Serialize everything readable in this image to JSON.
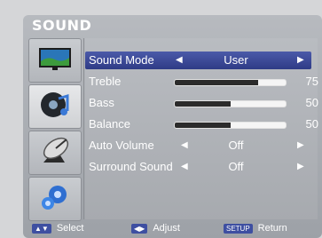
{
  "menu": {
    "title": "SOUND"
  },
  "sidebar": {
    "items": [
      {
        "name": "picture",
        "icon": "tv-screen-icon"
      },
      {
        "name": "sound",
        "icon": "music-note-icon",
        "active": true
      },
      {
        "name": "channel",
        "icon": "satellite-dish-icon"
      },
      {
        "name": "setup",
        "icon": "gears-icon"
      }
    ]
  },
  "settings": {
    "sound_mode": {
      "label": "Sound Mode",
      "value": "User"
    },
    "treble": {
      "label": "Treble",
      "value": "75",
      "level": 0.75
    },
    "bass": {
      "label": "Bass",
      "value": "50",
      "level": 0.5
    },
    "balance": {
      "label": "Balance",
      "value": "50",
      "level": 0.5
    },
    "auto_volume": {
      "label": "Auto Volume",
      "value": "Off"
    },
    "surround_sound": {
      "label": "Surround Sound",
      "value": "Off"
    }
  },
  "footer": {
    "select_label": "Select",
    "adjust_label": "Adjust",
    "setup_key": "SETUP",
    "return_label": "Return"
  },
  "colors": {
    "selected_row": "#3a4795",
    "panel": "#a9acb1"
  }
}
